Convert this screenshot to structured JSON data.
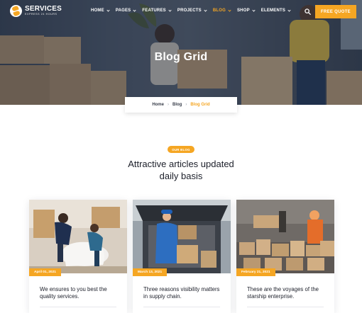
{
  "brand": {
    "name": "SERVICES",
    "tagline": "EXPRESS 24 HOURS"
  },
  "nav": {
    "items": [
      {
        "label": "HOME",
        "active": false
      },
      {
        "label": "PAGES",
        "active": false
      },
      {
        "label": "FEATURES",
        "active": false
      },
      {
        "label": "PROJECTS",
        "active": false
      },
      {
        "label": "BLOG",
        "active": true
      },
      {
        "label": "SHOP",
        "active": false
      },
      {
        "label": "ELEMENTS",
        "active": false
      }
    ],
    "search_icon": "search-icon",
    "cta_label": "FREE QUOTE"
  },
  "hero": {
    "title": "Blog Grid"
  },
  "breadcrumb": {
    "home": "Home",
    "blog": "Blog",
    "current": "Blog Grid"
  },
  "section": {
    "badge": "OUR BLOG",
    "title_line1": "Attractive articles updated",
    "title_line2": "daily basis"
  },
  "posts": [
    {
      "date": "April 01, 2021",
      "title": "We ensures to you best the quality services."
    },
    {
      "date": "March 13, 2021",
      "title": "Three reasons visibility matters in supply chain."
    },
    {
      "date": "February 21, 2021",
      "title": "These are the voyages of the starship enterprise."
    }
  ],
  "colors": {
    "accent": "#f5a623",
    "text": "#1c1f2a",
    "hero_overlay": "#1c2638"
  }
}
